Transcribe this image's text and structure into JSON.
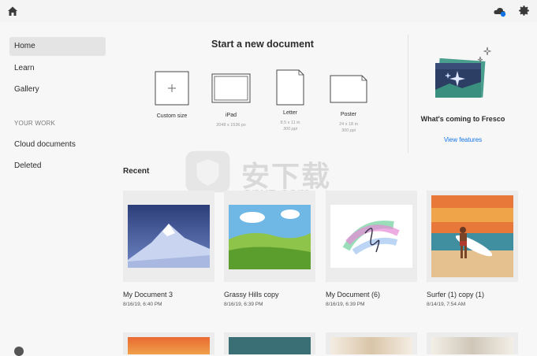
{
  "sidebar": {
    "items": [
      {
        "label": "Home"
      },
      {
        "label": "Learn"
      },
      {
        "label": "Gallery"
      }
    ],
    "section_heading": "YOUR WORK",
    "work_items": [
      {
        "label": "Cloud documents"
      },
      {
        "label": "Deleted"
      }
    ]
  },
  "new_document": {
    "title": "Start a new document",
    "templates": [
      {
        "label": "Custom size",
        "dims": "",
        "ppi": ""
      },
      {
        "label": "iPad",
        "dims": "2048 x 1536 px",
        "ppi": ""
      },
      {
        "label": "Letter",
        "dims": "8.5 x 11 in",
        "ppi": "300 ppi"
      },
      {
        "label": "Poster",
        "dims": "24 x 18 in",
        "ppi": "300 ppi"
      }
    ]
  },
  "whats_coming": {
    "title": "What's coming to Fresco",
    "link": "View features"
  },
  "recent": {
    "title": "Recent",
    "documents": [
      {
        "name": "My Document 3",
        "date": "8/16/19, 6:40 PM"
      },
      {
        "name": "Grassy Hills copy",
        "date": "8/16/19, 6:39 PM"
      },
      {
        "name": "My Document (6)",
        "date": "8/16/19, 6:39 PM"
      },
      {
        "name": "Surfer (1) copy (1)",
        "date": "8/14/19, 7:54 AM"
      }
    ]
  },
  "watermark": {
    "text": "安下载",
    "url": "anxz.com"
  },
  "icons": {
    "home": "home-icon",
    "cloud": "cloud-sync-icon",
    "settings": "gear-icon",
    "plus": "plus-icon",
    "sparkle": "sparkle-icon"
  },
  "colors": {
    "accent": "#1473e6",
    "active_bg": "#e4e4e4",
    "background": "#f7f7f7"
  }
}
